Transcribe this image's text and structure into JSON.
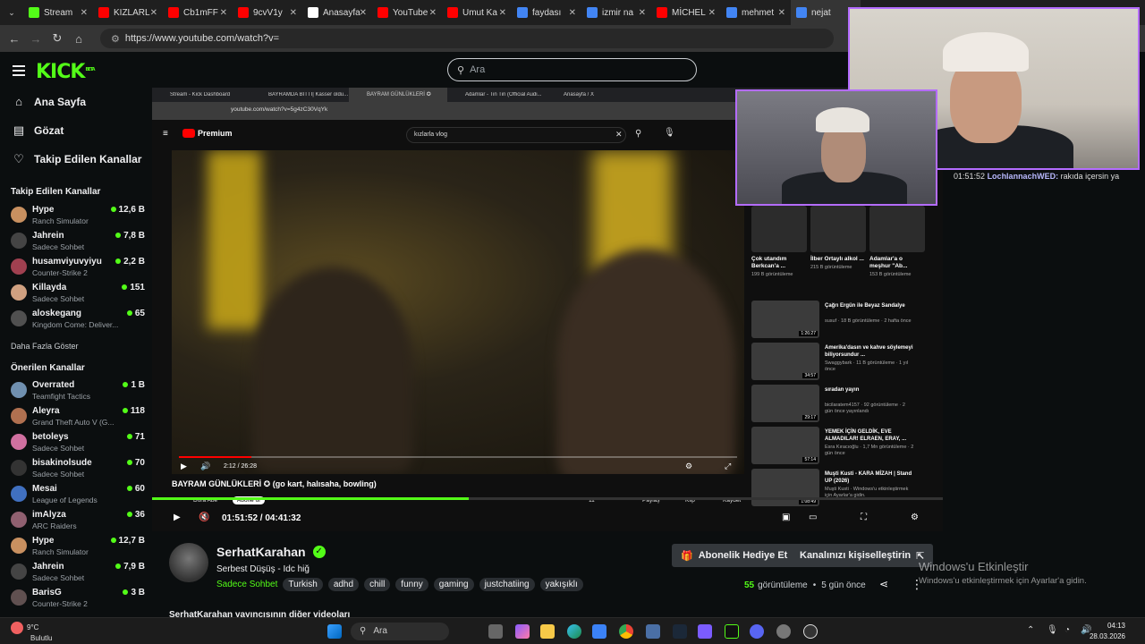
{
  "browser": {
    "tabs": [
      {
        "label": "Stream",
        "color": "#53fc18",
        "active": false
      },
      {
        "label": "KIZLARL",
        "color": "#ff0000",
        "active": false
      },
      {
        "label": "Cb1mFF",
        "color": "#ff0000",
        "active": false
      },
      {
        "label": "9cvV1y",
        "color": "#ff0000",
        "active": false
      },
      {
        "label": "Anasayfa",
        "color": "#ffffff",
        "active": false
      },
      {
        "label": "YouTube",
        "color": "#ff0000",
        "active": false
      },
      {
        "label": "Umut Ka",
        "color": "#ff0000",
        "active": false
      },
      {
        "label": "faydası",
        "color": "#4285f4",
        "active": false
      },
      {
        "label": "izmir na",
        "color": "#4285f4",
        "active": false
      },
      {
        "label": "MİCHEL",
        "color": "#ff0000",
        "active": false
      },
      {
        "label": "mehmet",
        "color": "#4285f4",
        "active": false
      },
      {
        "label": "nejat",
        "color": "#4285f4",
        "active": true
      }
    ],
    "url": "https://www.youtube.com/watch?v="
  },
  "kick": {
    "logo": "KICK",
    "logo_badge": "BETA",
    "search_placeholder": "Ara",
    "nav": [
      {
        "label": "Ana Sayfa",
        "icon": "home-icon"
      },
      {
        "label": "Gözat",
        "icon": "browse-icon"
      },
      {
        "label": "Takip Edilen Kanallar",
        "icon": "heart-icon"
      }
    ],
    "followed_title": "Takip Edilen Kanallar",
    "followed": [
      {
        "name": "Hype",
        "game": "Ranch Simulator",
        "viewers": "12,6 B",
        "color": "#c89060"
      },
      {
        "name": "Jahrein",
        "game": "Sadece Sohbet",
        "viewers": "7,8 B",
        "color": "#444444"
      },
      {
        "name": "husamviyuvyiyu",
        "game": "Counter-Strike 2",
        "viewers": "2,2 B",
        "color": "#a04050"
      },
      {
        "name": "Killayda",
        "game": "Sadece Sohbet",
        "viewers": "151",
        "color": "#d0a080"
      },
      {
        "name": "aloskegang",
        "game": "Kingdom Come: Deliver...",
        "viewers": "65",
        "color": "#505050"
      }
    ],
    "show_more": "Daha Fazla Göster",
    "recommended_title": "Önerilen Kanallar",
    "recommended": [
      {
        "name": "Overrated",
        "game": "Teamfight Tactics",
        "viewers": "1 B",
        "color": "#7090b0"
      },
      {
        "name": "Aleyra",
        "game": "Grand Theft Auto V (G...",
        "viewers": "118",
        "color": "#b07050"
      },
      {
        "name": "betoleys",
        "game": "Sadece Sohbet",
        "viewers": "71",
        "color": "#d070a0"
      },
      {
        "name": "bisakinolsude",
        "game": "Sadece Sohbet",
        "viewers": "70",
        "color": "#333333"
      },
      {
        "name": "Mesai",
        "game": "League of Legends",
        "viewers": "60",
        "color": "#4070c0"
      },
      {
        "name": "imAlyza",
        "game": "ARC Raiders",
        "viewers": "36",
        "color": "#906070"
      },
      {
        "name": "Hype",
        "game": "Ranch Simulator",
        "viewers": "12,7 B",
        "color": "#c89060"
      },
      {
        "name": "Jahrein",
        "game": "Sadece Sohbet",
        "viewers": "7,9 B",
        "color": "#444444"
      },
      {
        "name": "BarisG",
        "game": "Counter-Strike 2",
        "viewers": "3 B",
        "color": "#605050"
      }
    ]
  },
  "stream_view": {
    "inner_tabs": [
      "Stream - Kick Dashboard",
      "BAYRAMDA BİTTİ| Kasser oldu...",
      "BAYRAM GÜNLÜKLERİ ✪",
      "Adamlar - Tin Tin (Official Audi...",
      "Anasayfa / X"
    ],
    "inner_url": "youtube.com/watch?v=5g4zC30VqYk",
    "yt_logo": "Premium",
    "yt_search": "kızlarla vlog",
    "video_time": "2:12 / 26:28",
    "video_title": "BAYRAM GÜNLÜKLERİ ✪ (go kart, halısaha, bowling)",
    "below": {
      "channel": "Dora Abe",
      "subs": "75 abone",
      "subscribe": "Abone ol",
      "likes": "11",
      "share": "Paylaş",
      "clip": "Klip",
      "save": "Kaydet"
    },
    "shorts": [
      {
        "title": "Çok utandım Berkcan'a ...",
        "views": "199 B görüntüleme"
      },
      {
        "title": "İlber Ortaylı alkol ...",
        "views": "215 B görüntüleme"
      },
      {
        "title": "Adamlar'a o meşhur \"Ab...",
        "views": "153 B görüntüleme"
      }
    ],
    "recommendations": [
      {
        "title": "Çağrı Ergün ile Beyaz Sandalye",
        "meta": "susuf · 18 B görüntüleme · 2 hafta önce",
        "duration": "1:26:27"
      },
      {
        "title": "Amerika'dasın ve kahve söylemeyi biliyorsundur ...",
        "meta": "Swaggybark · 11 B görüntüleme · 1 yıl önce",
        "duration": "34:57"
      },
      {
        "title": "sıradan yayın",
        "meta": "bicilaratem4157 · 92 görüntüleme · 2 gün önce yayınlandı",
        "duration": "29:17"
      },
      {
        "title": "YEMEK İÇİN GELDİK, EVE ALMADILAR! ELRAEN, ERAY, ...",
        "meta": "Esra Kıracıoğlu · 1,7 Mn görüntüleme · 2 gün önce",
        "duration": "57:14"
      },
      {
        "title": "Muşti Kusti - KARA MİZAH | Stand UP (2026)",
        "meta": "Muşti Kusti · Windows'u etkinleştirmek için Ayarlar'a gidin.",
        "duration": "1:08:49"
      }
    ],
    "stream_time": "01:51:52 / 04:41:32",
    "inner_taskbar_search": "Ara",
    "inner_clock": "02:04"
  },
  "chat": {
    "time": "01:51:52",
    "user": "LochlannachWED:",
    "message": " rakıda içersin ya"
  },
  "channel": {
    "name": "SerhatKarahan",
    "title": "Serbest Düşüş - Idc hiğ",
    "category": "Sadece Sohbet",
    "tags": [
      "Turkish",
      "adhd",
      "chill",
      "funny",
      "gaming",
      "justchatiing",
      "yakışıklı"
    ],
    "gift_button": "Abonelik Hediye Et",
    "customize_button": "Kanalınızı kişiselleştirin",
    "views": "55",
    "views_label": "görüntüleme",
    "time_ago": "5 gün önce",
    "other_videos": "SerhatKarahan yayıncısının diğer videoları"
  },
  "windows_activation": {
    "title": "Windows'u Etkinleştir",
    "subtitle": "Windows'u etkinleştirmek için Ayarlar'a gidin."
  },
  "taskbar": {
    "temp": "9°C",
    "weather": "Bulutlu",
    "search": "Ara",
    "time": "04:13",
    "date": "28.03.2026"
  }
}
